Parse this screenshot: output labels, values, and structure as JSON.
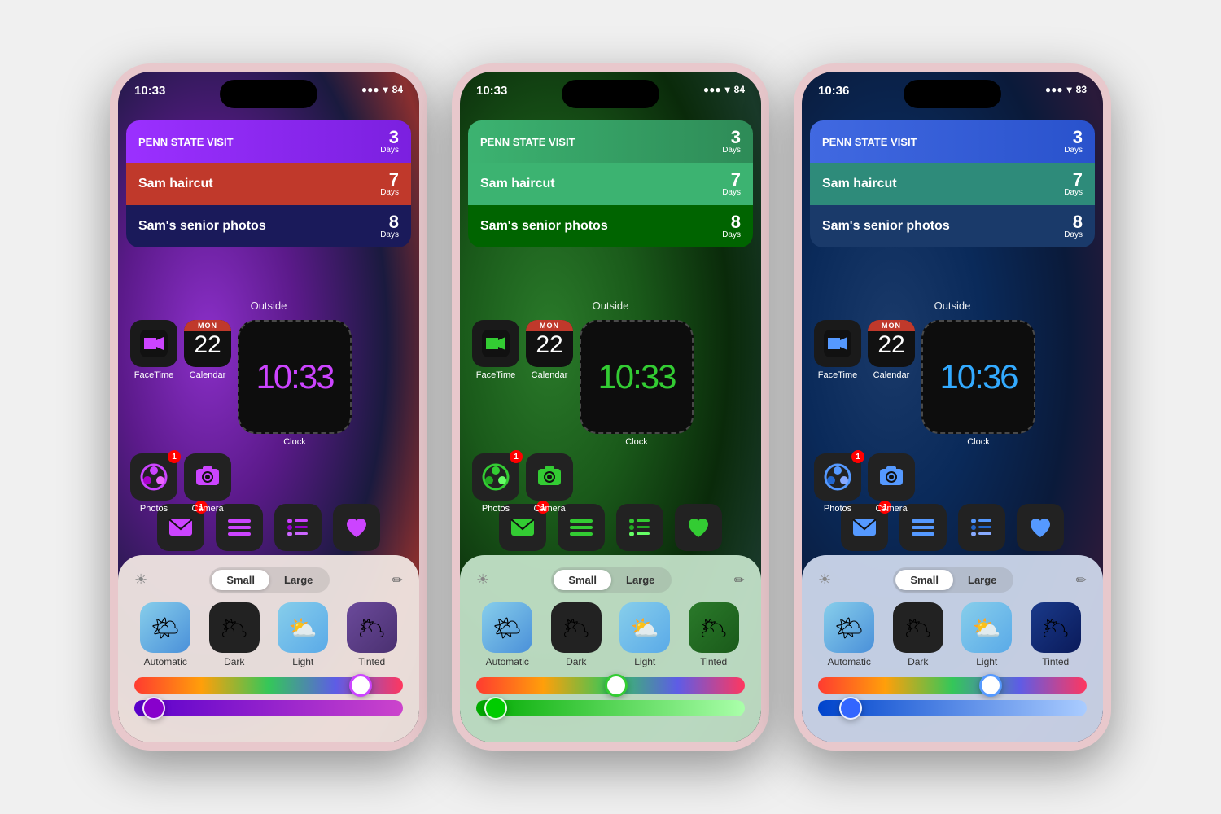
{
  "phones": [
    {
      "id": "phone1",
      "status": {
        "time": "10:33",
        "signal": "●●●",
        "wifi": "wifi",
        "battery": "84"
      },
      "wallpaper": "wallpaper-1",
      "accentColor": "#CC44FF",
      "countdown": {
        "row1": {
          "title": "PENN STATE VISIT",
          "days": "3",
          "label": "Days"
        },
        "row2": {
          "title": "Sam haircut",
          "days": "7",
          "label": "Days"
        },
        "row3": {
          "title": "Sam's senior photos",
          "days": "8",
          "label": "Days"
        }
      },
      "outsideLabel": "Outside",
      "appGrid": [
        {
          "name": "FaceTime",
          "bg": "#111",
          "emoji": "📹",
          "color": "#CC44FF"
        },
        {
          "name": "Calendar",
          "bg": "#111",
          "emoji": "📅",
          "hasDate": true
        },
        {
          "name": "Clock",
          "bg": "#111",
          "isWidget": true
        }
      ],
      "row2Apps": [
        {
          "name": "Photos",
          "bg": "#222",
          "emoji": "🌸",
          "color": "#CC44FF",
          "badge": "1"
        },
        {
          "name": "Camera",
          "bg": "#222",
          "emoji": "📷",
          "color": "#CC44FF"
        }
      ],
      "dock": [
        {
          "name": "Mail",
          "bg": "#222",
          "emoji": "✉️",
          "badge": "1"
        },
        {
          "name": "Reminders",
          "bg": "#222",
          "emoji": "☰"
        },
        {
          "name": "Lists",
          "bg": "#222",
          "emoji": "⋮"
        },
        {
          "name": "Health",
          "bg": "#222",
          "emoji": "♥"
        }
      ],
      "panel": {
        "sizeSmall": "Small",
        "sizeLarge": "Large",
        "activeSize": "Small",
        "iconStyles": [
          {
            "name": "Automatic",
            "bg": "linear-gradient(135deg, #87CEEB, #4A90D9)"
          },
          {
            "name": "Dark",
            "bg": "#222"
          },
          {
            "name": "Light",
            "bg": "linear-gradient(135deg, #87CEEB, #4A90D9)"
          },
          {
            "name": "Tinted",
            "bg": "linear-gradient(135deg, #6B4A9B, #4A3070)"
          }
        ],
        "slider1Pos": "80%",
        "slider2Pos": "5%"
      }
    },
    {
      "id": "phone2",
      "status": {
        "time": "10:33",
        "battery": "84"
      },
      "wallpaper": "wallpaper-2",
      "accentColor": "#33CC33",
      "countdown": {
        "row1": {
          "title": "PENN STATE VISIT",
          "days": "3",
          "label": "Days"
        },
        "row2": {
          "title": "Sam haircut",
          "days": "7",
          "label": "Days"
        },
        "row3": {
          "title": "Sam's senior photos",
          "days": "8",
          "label": "Days"
        }
      },
      "outsideLabel": "Outside",
      "panel": {
        "sizeSmall": "Small",
        "sizeLarge": "Large",
        "activeSize": "Small",
        "iconStyles": [
          {
            "name": "Automatic",
            "bg": "linear-gradient(135deg, #87CEEB, #4A90D9)"
          },
          {
            "name": "Dark",
            "bg": "#222"
          },
          {
            "name": "Light",
            "bg": "linear-gradient(135deg, #87CEEB, #4A90D9)"
          },
          {
            "name": "Tinted",
            "bg": "linear-gradient(135deg, #33AA33, #1a7a1a)"
          }
        ],
        "slider1Pos": "50%",
        "slider2Pos": "5%"
      }
    },
    {
      "id": "phone3",
      "status": {
        "time": "10:36",
        "battery": "83"
      },
      "wallpaper": "wallpaper-3",
      "accentColor": "#33AAFF",
      "countdown": {
        "row1": {
          "title": "PENN STATE VISIT",
          "days": "3",
          "label": "Days"
        },
        "row2": {
          "title": "Sam haircut",
          "days": "7",
          "label": "Days"
        },
        "row3": {
          "title": "Sam's senior photos",
          "days": "8",
          "label": "Days"
        }
      },
      "outsideLabel": "Outside",
      "panel": {
        "sizeSmall": "Small",
        "sizeLarge": "Large",
        "activeSize": "Small",
        "iconStyles": [
          {
            "name": "Automatic",
            "bg": "linear-gradient(135deg, #87CEEB, #4A90D9)"
          },
          {
            "name": "Dark",
            "bg": "#222"
          },
          {
            "name": "Light",
            "bg": "linear-gradient(135deg, #87CEEB, #4A90D9)"
          },
          {
            "name": "Tinted",
            "bg": "linear-gradient(135deg, #3355AA, #1a2a6a)"
          }
        ],
        "slider1Pos": "62%",
        "slider2Pos": "10%"
      }
    }
  ]
}
